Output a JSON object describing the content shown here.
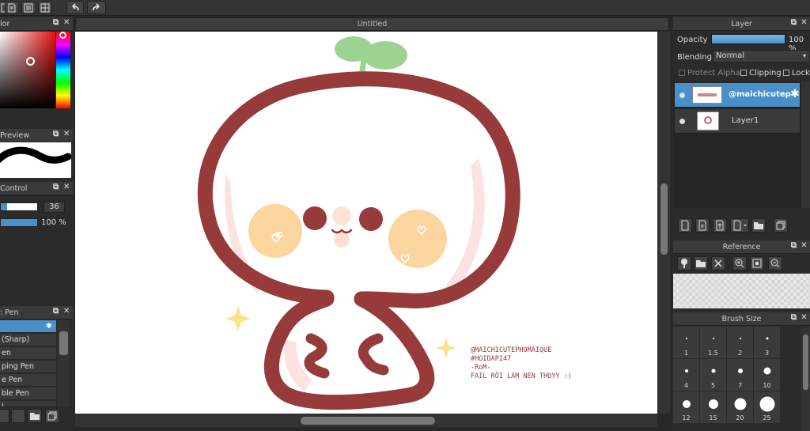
{
  "toolbar": {
    "icons": [
      "new-file-icon",
      "file-open-icon",
      "filter-icon",
      "grid-icon",
      "undo-icon",
      "redo-icon"
    ]
  },
  "document": {
    "tab_title": "Untitled"
  },
  "left": {
    "color_panel": {
      "title": "lor"
    },
    "preview_panel": {
      "title": "Preview"
    },
    "control_panel": {
      "title": "Control",
      "size_value": "36",
      "opacity_value": "100 %"
    },
    "brush_panel": {
      "title": ": Pen",
      "items": [
        "",
        "(Sharp)",
        "en",
        "ping Pen",
        "e Pen",
        "ble Pen",
        "l"
      ]
    }
  },
  "layer_panel": {
    "title": "Layer",
    "opacity_label": "Opacity",
    "opacity_value": "100 %",
    "opacity_level": 1.0,
    "blending_label": "Blending",
    "blending_value": "Normal",
    "protect_alpha_label": "Protect Alpha",
    "clipping_label": "Clipping",
    "lock_label": "Lock",
    "layers": [
      {
        "name": "@maichicutep",
        "selected": true
      },
      {
        "name": "Layer1",
        "selected": false
      }
    ]
  },
  "reference_panel": {
    "title": "Reference"
  },
  "brush_size_panel": {
    "title": "Brush Size",
    "sizes": [
      "1",
      "1.5",
      "2",
      "3",
      "4",
      "5",
      "7",
      "10",
      "12",
      "15",
      "20",
      "25"
    ]
  },
  "artwork": {
    "caption_lines": [
      "@MAICHICUTEPHOMAIQUE",
      "#HOIDAP247",
      "-RoM-",
      "FAIL RỒI LÀM NÈN THOYY :("
    ]
  },
  "colors": {
    "accent_blue": "#4a90c8",
    "outline": "#963a3a",
    "leaf": "#9dd391",
    "cheek": "#fcd69f",
    "panel_bg": "#2b2b2b"
  }
}
